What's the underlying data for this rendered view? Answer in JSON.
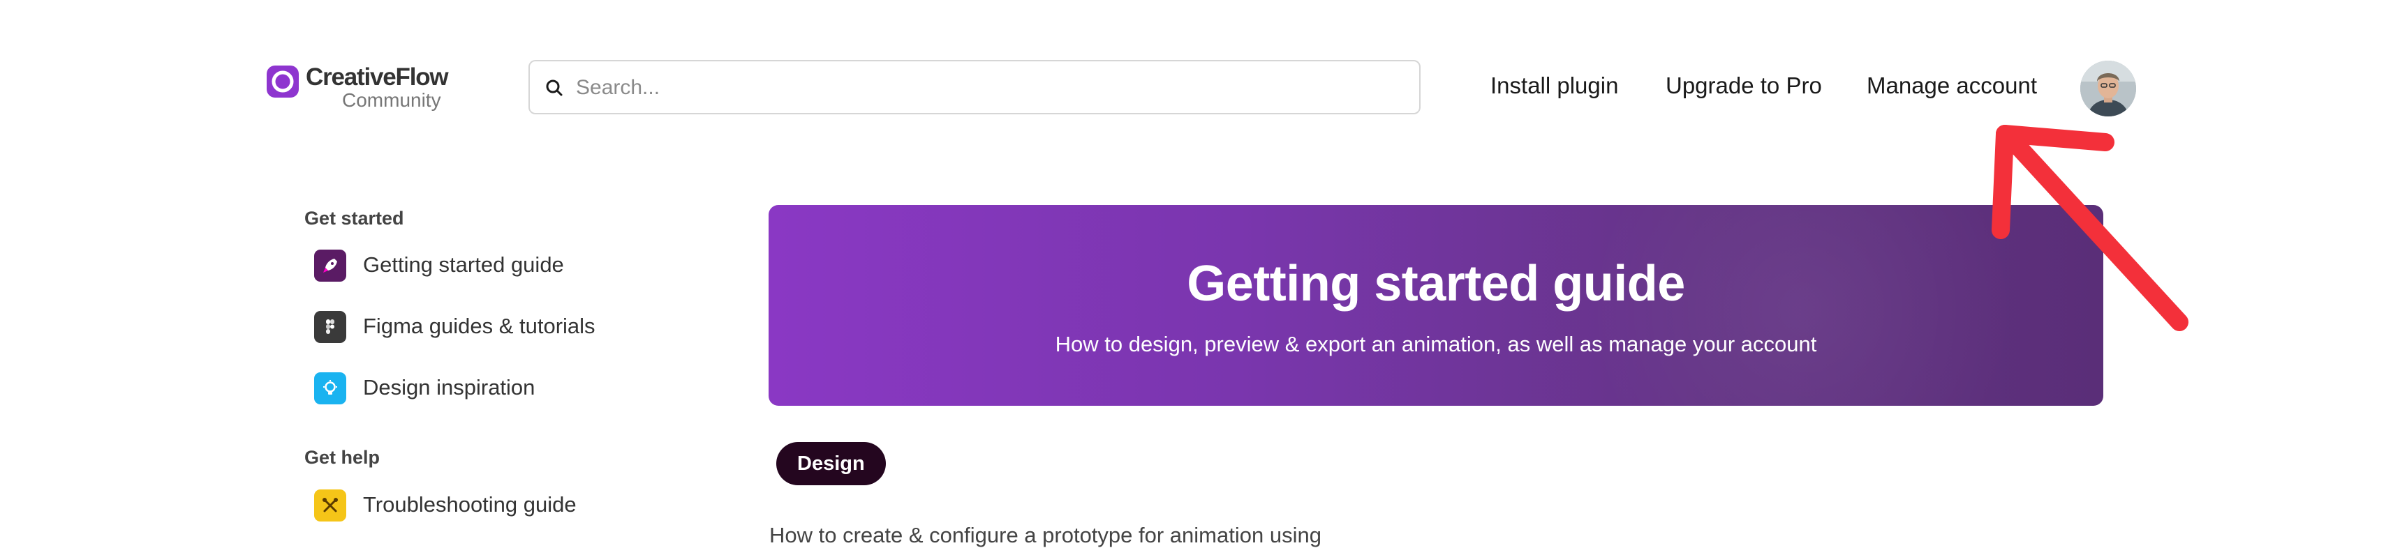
{
  "header": {
    "logo": {
      "name": "CreativeFlow",
      "subtitle": "Community"
    },
    "search": {
      "placeholder": "Search..."
    },
    "nav": [
      "Install plugin",
      "Upgrade to Pro",
      "Manage account"
    ]
  },
  "sidebar": {
    "sections": [
      {
        "heading": "Get started",
        "items": [
          {
            "label": "Getting started guide",
            "icon": "rocket-icon",
            "color": "#5a1b64"
          },
          {
            "label": "Figma guides & tutorials",
            "icon": "figma-icon",
            "color": "#3a3a3a"
          },
          {
            "label": "Design inspiration",
            "icon": "lightbulb-icon",
            "color": "#1ab3f0"
          }
        ]
      },
      {
        "heading": "Get help",
        "items": [
          {
            "label": "Troubleshooting guide",
            "icon": "tools-icon",
            "color": "#f5c518"
          }
        ]
      }
    ]
  },
  "banner": {
    "title": "Getting started guide",
    "subtitle": "How to design, preview & export an animation, as well as manage your account"
  },
  "tag": "Design",
  "body_text": "How to create & configure a prototype for animation using",
  "colors": {
    "accent": "#8a38c4",
    "banner_end": "#5a2e78",
    "tag_bg": "#24061f",
    "arrow": "#f3303a"
  }
}
